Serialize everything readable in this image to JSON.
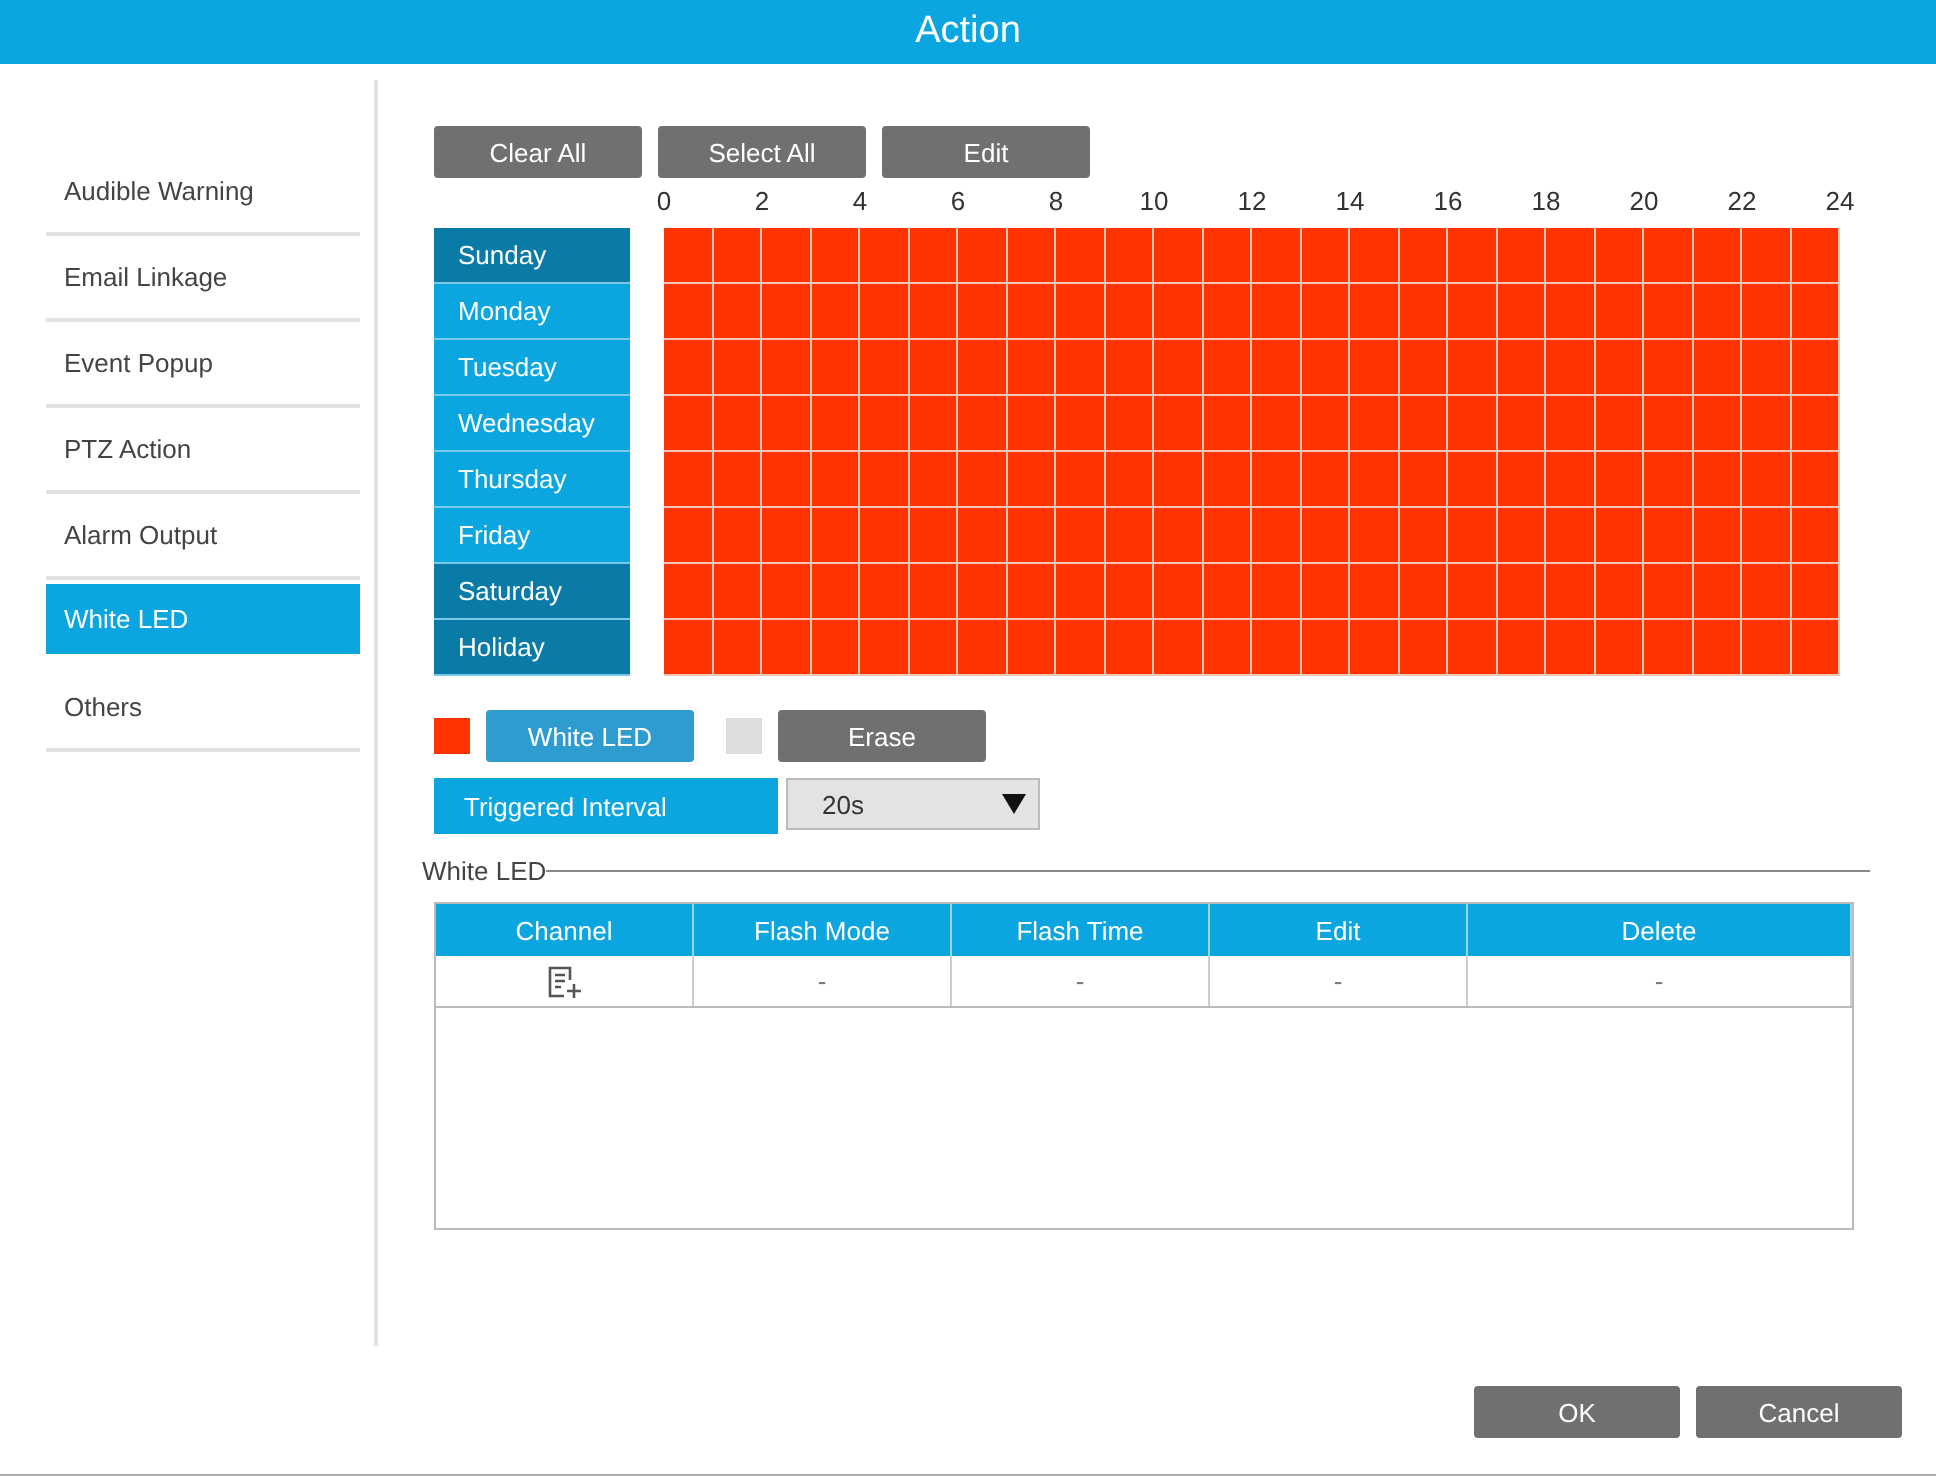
{
  "window": {
    "title": "Action"
  },
  "sidebar": {
    "items": [
      {
        "label": "Audible Warning",
        "selected": false
      },
      {
        "label": "Email Linkage",
        "selected": false
      },
      {
        "label": "Event Popup",
        "selected": false
      },
      {
        "label": "PTZ Action",
        "selected": false
      },
      {
        "label": "Alarm Output",
        "selected": false
      },
      {
        "label": "White LED",
        "selected": true
      },
      {
        "label": "Others",
        "selected": false
      }
    ]
  },
  "schedule": {
    "buttons": [
      "Clear All",
      "Select All",
      "Edit"
    ],
    "hour_ticks": [
      "0",
      "2",
      "4",
      "6",
      "8",
      "10",
      "12",
      "14",
      "16",
      "18",
      "20",
      "22",
      "24"
    ],
    "days": [
      {
        "label": "Sunday",
        "color": "#0a7aa6",
        "scheduled": true
      },
      {
        "label": "Monday",
        "color": "#0ba6e0",
        "scheduled": true
      },
      {
        "label": "Tuesday",
        "color": "#0ba6e0",
        "scheduled": true
      },
      {
        "label": "Wednesday",
        "color": "#0ba6e0",
        "scheduled": true
      },
      {
        "label": "Thursday",
        "color": "#0ba6e0",
        "scheduled": true
      },
      {
        "label": "Friday",
        "color": "#0ba6e0",
        "scheduled": true
      },
      {
        "label": "Saturday",
        "color": "#0a7aa6",
        "scheduled": true
      },
      {
        "label": "Holiday",
        "color": "#0a7aa6",
        "scheduled": true
      }
    ],
    "modes": [
      {
        "label": "White LED",
        "color": "#ff3300",
        "selected": true
      },
      {
        "label": "Erase",
        "color": "#dddddd",
        "selected": false
      }
    ]
  },
  "triggered_interval": {
    "label": "Triggered Interval",
    "value": "20s"
  },
  "white_led": {
    "title": "White LED",
    "columns": [
      "Channel",
      "Flash Mode",
      "Flash Time",
      "Edit",
      "Delete"
    ],
    "rows": [
      {
        "flash_mode": "-",
        "flash_time": "-",
        "edit": "-",
        "delete": "-"
      }
    ]
  },
  "buttons": [
    "OK",
    "Cancel"
  ]
}
